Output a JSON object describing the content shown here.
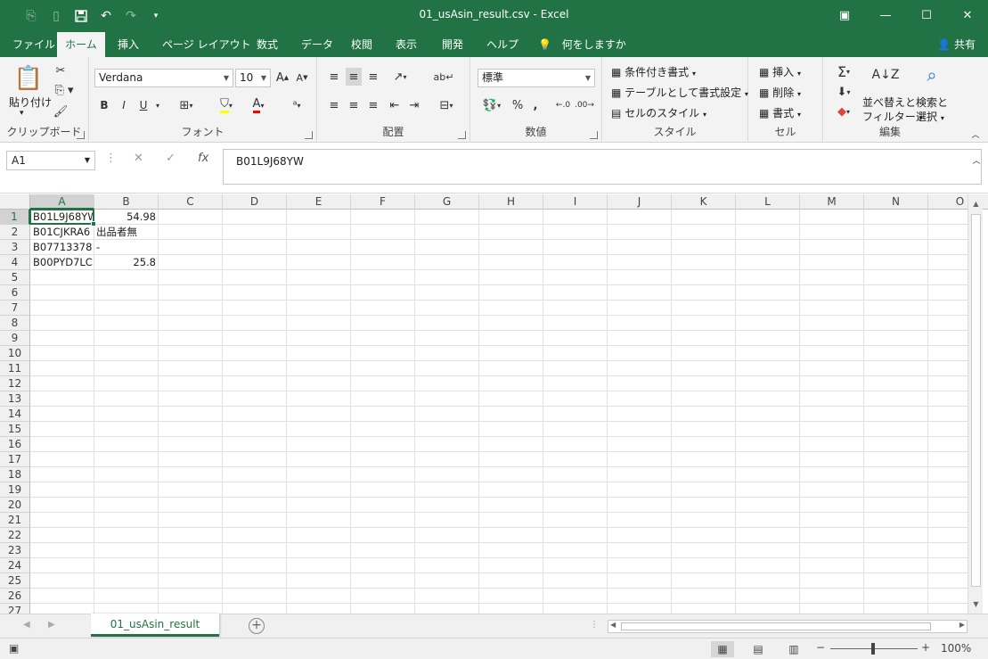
{
  "window": {
    "title": "01_usAsin_result.csv  -  Excel",
    "qat": [
      "autosave-icon",
      "save-icon",
      "undo-icon",
      "redo-icon",
      "customize-icon"
    ],
    "controls": [
      "ribbon-display-icon",
      "minimize-icon",
      "maximize-icon",
      "close-icon"
    ]
  },
  "tabs": [
    {
      "label": "ファイル",
      "active": false
    },
    {
      "label": "ホーム",
      "active": true
    },
    {
      "label": "挿入",
      "active": false
    },
    {
      "label": "ページ レイアウト",
      "active": false
    },
    {
      "label": "数式",
      "active": false
    },
    {
      "label": "データ",
      "active": false
    },
    {
      "label": "校閲",
      "active": false
    },
    {
      "label": "表示",
      "active": false
    },
    {
      "label": "開発",
      "active": false
    },
    {
      "label": "ヘルプ",
      "active": false
    }
  ],
  "tell_me": "何をしますか",
  "share": "共有",
  "ribbon": {
    "clipboard": {
      "label": "クリップボード",
      "paste": "貼り付け"
    },
    "font": {
      "label": "フォント",
      "font_name": "Verdana",
      "font_size": "10",
      "bold": "B",
      "italic": "I",
      "underline": "U"
    },
    "alignment": {
      "label": "配置"
    },
    "number": {
      "label": "数値",
      "format": "標準",
      "percent": "%",
      "comma": ","
    },
    "styles": {
      "label": "スタイル",
      "conditional": "条件付き書式",
      "table": "テーブルとして書式設定",
      "cell_styles": "セルのスタイル"
    },
    "cells": {
      "label": "セル",
      "insert": "挿入",
      "delete": "削除",
      "format": "書式"
    },
    "editing": {
      "label": "編集",
      "sort_line1": "並べ替えと",
      "sort_line2": "フィルター",
      "find_line1": "検索と",
      "find_line2": "選択"
    }
  },
  "formula_bar": {
    "name_box": "A1",
    "value": "B01L9J68YW",
    "fx": "fx"
  },
  "columns": [
    "A",
    "B",
    "C",
    "D",
    "E",
    "F",
    "G",
    "H",
    "I",
    "J",
    "K",
    "L",
    "M",
    "N",
    "O"
  ],
  "rows": [
    "1",
    "2",
    "3",
    "4",
    "5",
    "6",
    "7",
    "8",
    "9",
    "10",
    "11",
    "12",
    "13",
    "14",
    "15",
    "16",
    "17",
    "18",
    "19",
    "20",
    "21",
    "22",
    "23",
    "24",
    "25",
    "26",
    "27"
  ],
  "cells": [
    {
      "a": "B01L9J68YW",
      "b": "54.98",
      "b_num": true
    },
    {
      "a": "B01CJKRA6",
      "b": "出品者無",
      "b_num": false
    },
    {
      "a": "B07713378",
      "b": "-",
      "b_num": false
    },
    {
      "a": "B00PYD7LC",
      "b": "25.8",
      "b_num": true
    }
  ],
  "sheet": {
    "tab": "01_usAsin_result"
  },
  "status": {
    "zoom": "100%",
    "minus": "−",
    "plus": "+"
  }
}
